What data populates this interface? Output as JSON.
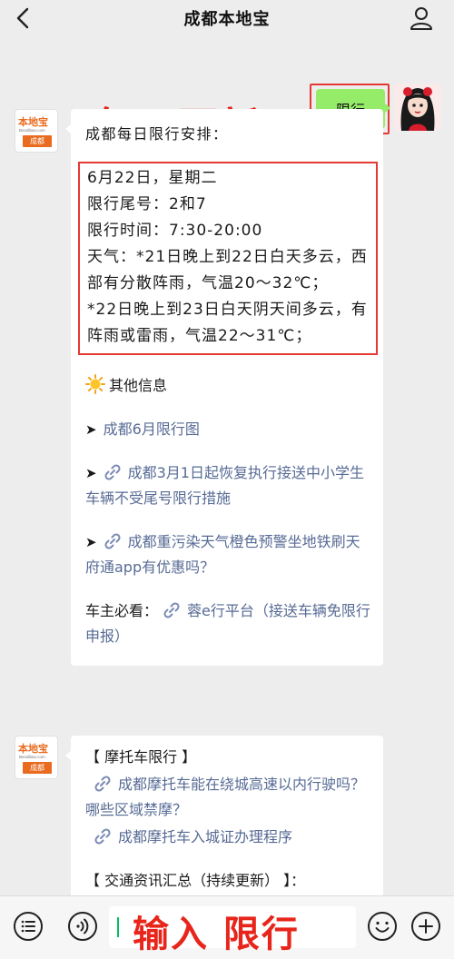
{
  "topbar": {
    "title": "成都本地宝"
  },
  "overlay": {
    "banner": "每日更新"
  },
  "outgoing": {
    "text": "限行"
  },
  "bot": {
    "logo_top": "本地宝",
    "logo_url": "Bendibao.com",
    "logo_badge": "成都"
  },
  "message1": {
    "heading": "成都每日限行安排：",
    "schedule": [
      "6月22日，星期二",
      "限行尾号：2和7",
      "限行时间：7:30-20:00",
      "天气：*21日晚上到22日白天多云，西部有分散阵雨，气温20～32℃；",
      "*22日晚上到23日白天阴天间多云，有阵雨或雷雨，气温22～31℃；"
    ],
    "other_info": "其他信息",
    "links": [
      {
        "arrow": "➤",
        "has_icon": false,
        "text": "成都6月限行图"
      },
      {
        "arrow": "➤",
        "has_icon": true,
        "text": "成都3月1日起恢复执行接送中小学生车辆不受尾号限行措施"
      },
      {
        "arrow": "➤",
        "has_icon": true,
        "text": "成都重污染天气橙色预警坐地铁刷天府通app有优惠吗？"
      }
    ],
    "owner_prefix": "车主必看：",
    "owner_link": "蓉e行平台（接送车辆免限行申报）"
  },
  "message2": {
    "section1": "【 摩托车限行 】",
    "links": [
      "成都摩托车能在绕城高速以内行驶吗？哪些区域禁摩？",
      "成都摩托车入城证办理程序"
    ],
    "section2": "【 交通资讯汇总（持续更新） 】："
  },
  "inputbar": {
    "text": "输入 限行"
  },
  "colors": {
    "accent_red": "#e8251b",
    "link": "#576b95",
    "bubble_green": "#95ec69",
    "brand_orange": "#e96b1f"
  }
}
